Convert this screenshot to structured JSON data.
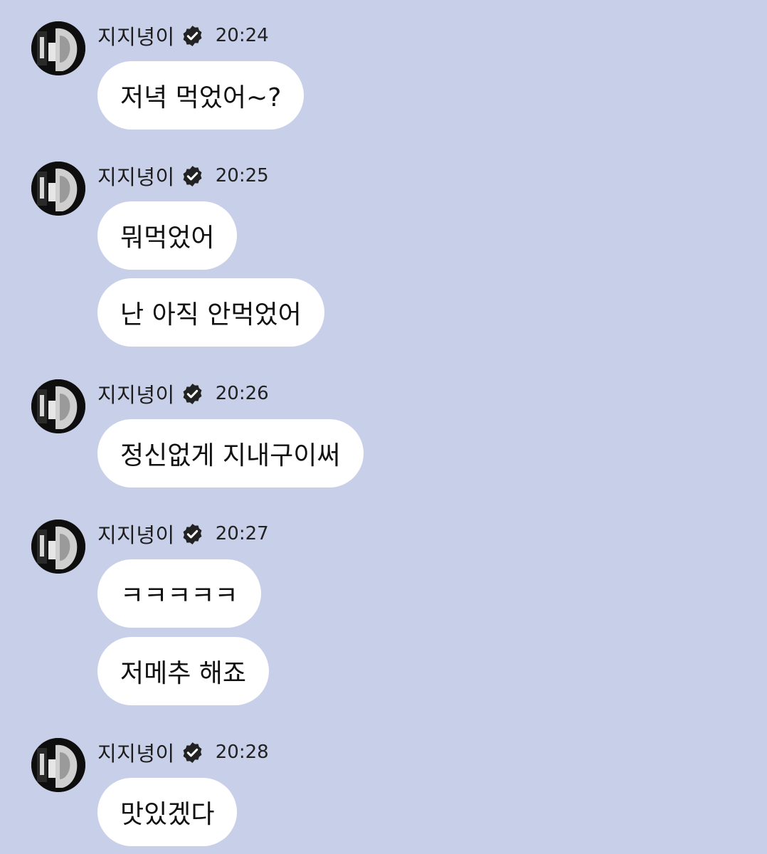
{
  "conversation": {
    "groups": [
      {
        "sender": "지지녕이",
        "time": "20:24",
        "messages": [
          "저녁 먹었어~?"
        ]
      },
      {
        "sender": "지지녕이",
        "time": "20:25",
        "messages": [
          "뭐먹었어",
          "난 아직 안먹었어"
        ]
      },
      {
        "sender": "지지녕이",
        "time": "20:26",
        "messages": [
          "정신없게 지내구이써"
        ]
      },
      {
        "sender": "지지녕이",
        "time": "20:27",
        "messages": [
          "ㅋㅋㅋㅋㅋ",
          "저메추 해죠"
        ]
      },
      {
        "sender": "지지녕이",
        "time": "20:28",
        "messages": [
          "맛있겠다"
        ]
      }
    ]
  },
  "icons": {
    "verified": "verified-badge-icon",
    "avatar": "profile-photo"
  },
  "colors": {
    "background": "#c8cfe8",
    "bubble": "#ffffff",
    "text": "#111111",
    "badge": "#222222"
  }
}
